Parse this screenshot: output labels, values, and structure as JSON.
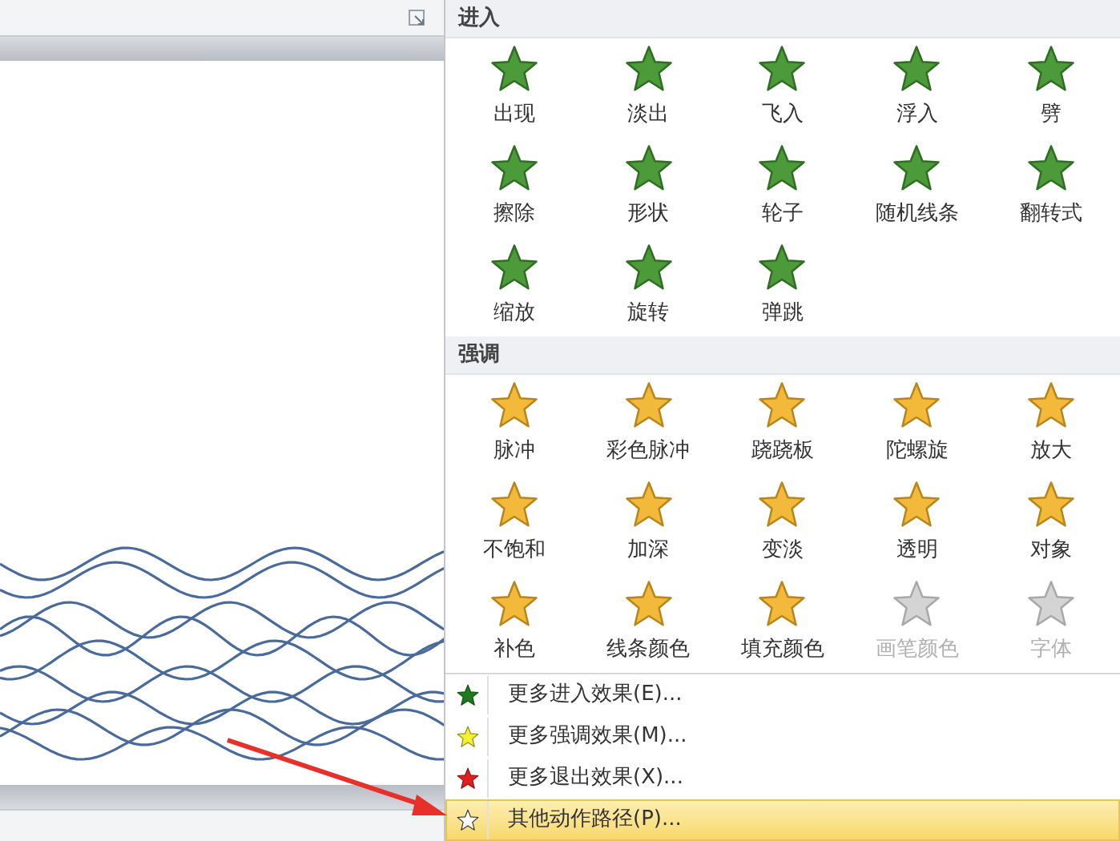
{
  "sections": [
    {
      "title": "进入",
      "kind": "entrance",
      "effects": [
        {
          "label": "出现",
          "disabled": false
        },
        {
          "label": "淡出",
          "disabled": false
        },
        {
          "label": "飞入",
          "disabled": false
        },
        {
          "label": "浮入",
          "disabled": false
        },
        {
          "label": "劈",
          "disabled": false
        },
        {
          "label": "擦除",
          "disabled": false
        },
        {
          "label": "形状",
          "disabled": false
        },
        {
          "label": "轮子",
          "disabled": false
        },
        {
          "label": "随机线条",
          "disabled": false
        },
        {
          "label": "翻转式",
          "disabled": false
        },
        {
          "label": "缩放",
          "disabled": false
        },
        {
          "label": "旋转",
          "disabled": false
        },
        {
          "label": "弹跳",
          "disabled": false
        }
      ]
    },
    {
      "title": "强调",
      "kind": "emphasis",
      "effects": [
        {
          "label": "脉冲",
          "disabled": false
        },
        {
          "label": "彩色脉冲",
          "disabled": false
        },
        {
          "label": "跷跷板",
          "disabled": false
        },
        {
          "label": "陀螺旋",
          "disabled": false
        },
        {
          "label": "放大",
          "disabled": false
        },
        {
          "label": "不饱和",
          "disabled": false
        },
        {
          "label": "加深",
          "disabled": false
        },
        {
          "label": "变淡",
          "disabled": false
        },
        {
          "label": "透明",
          "disabled": false
        },
        {
          "label": "对象",
          "disabled": false
        },
        {
          "label": "补色",
          "disabled": false
        },
        {
          "label": "线条颜色",
          "disabled": false
        },
        {
          "label": "填充颜色",
          "disabled": false
        },
        {
          "label": "画笔颜色",
          "disabled": true
        },
        {
          "label": "字体",
          "disabled": true
        }
      ]
    }
  ],
  "menu_items": [
    {
      "label": "更多进入效果(E)...",
      "kind": "entrance",
      "selected": false
    },
    {
      "label": "更多强调效果(M)...",
      "kind": "emphasis",
      "selected": false
    },
    {
      "label": "更多退出效果(X)...",
      "kind": "exit",
      "selected": false
    },
    {
      "label": "其他动作路径(P)...",
      "kind": "path",
      "selected": true
    }
  ]
}
